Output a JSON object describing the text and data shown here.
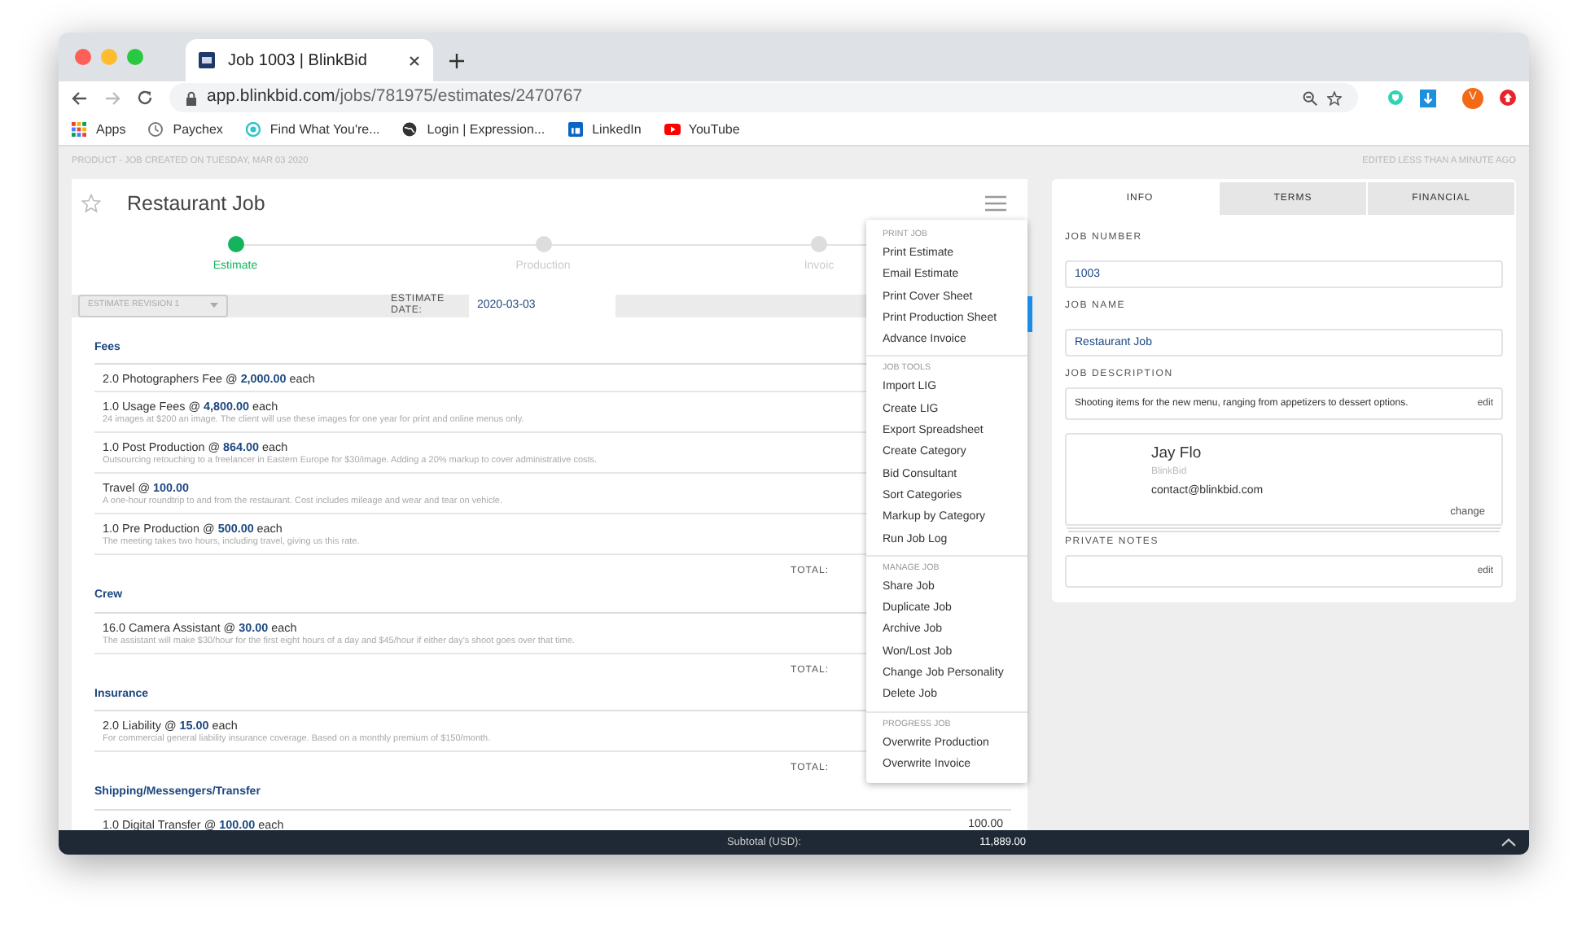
{
  "browser": {
    "tab_title": "Job 1003 | BlinkBid",
    "url_host": "app.blinkbid.com",
    "url_path": "/jobs/781975/estimates/2470767",
    "avatar_letter": "V",
    "bookmarks": [
      {
        "label": "Apps",
        "kind": "apps"
      },
      {
        "label": "Paychex",
        "kind": "clock"
      },
      {
        "label": "Find What You're...",
        "kind": "ring"
      },
      {
        "label": "Login | Expression...",
        "kind": "globe"
      },
      {
        "label": "LinkedIn",
        "kind": "square"
      },
      {
        "label": "YouTube",
        "kind": "play"
      }
    ]
  },
  "meta": {
    "created": "PRODUCT - JOB CREATED ON TUESDAY, MAR 03 2020",
    "edited": "EDITED LESS THAN A MINUTE AGO"
  },
  "job": {
    "title": "Restaurant Job",
    "starred": false,
    "steps": [
      {
        "label": "Estimate",
        "selected": true
      },
      {
        "label": "Production",
        "selected": false
      },
      {
        "label": "Invoic",
        "selected": false
      }
    ],
    "revision": "ESTIMATE REVISION 1",
    "date_label": "ESTIMATE DATE:",
    "date": "2020-03-03"
  },
  "categories": [
    {
      "name": "Fees",
      "total_label": "TOTAL:",
      "items": [
        {
          "line": "2.0 Photographers Fee @ **2,000.00** each"
        },
        {
          "line": "1.0 Usage Fees @ **4,800.00** each",
          "description": "24 images at $200 an image. The client will use these images for one year for print and online menus only."
        },
        {
          "line": "1.0 Post Production @ **864.00** each",
          "description": "Outsourcing retouching to a freelancer in Eastern Europe for $30/image. Adding a 20% markup to cover administrative costs."
        },
        {
          "line": "Travel @ **100.00**",
          "description": "A one-hour roundtrip to and from the restaurant. Cost includes mileage and wear and tear on vehicle."
        },
        {
          "line": "1.0 Pre Production @ **500.00** each",
          "description": "The meeting takes two hours, including travel, giving us this rate."
        }
      ]
    },
    {
      "name": "Crew",
      "total_label": "TOTAL:",
      "items": [
        {
          "line": "16.0 Camera Assistant @ **30.00** each",
          "description": "The assistant will make $30/hour for the first eight hours of a day and $45/hour if either day's shoot goes over that time."
        }
      ]
    },
    {
      "name": "Insurance",
      "total_label": "TOTAL:",
      "items": [
        {
          "line": "2.0 Liability @ **15.00** each",
          "description": "For commercial general liability insurance coverage. Based on a monthly premium of $150/month."
        }
      ]
    },
    {
      "name": "Shipping/Messengers/Transfer",
      "items": [
        {
          "line": "1.0 Digital Transfer @ **100.00** each",
          "amount": "100.00"
        }
      ]
    }
  ],
  "menu": [
    {
      "heading": "PRINT JOB",
      "items": [
        "Print Estimate",
        "Email Estimate",
        "Print Cover Sheet",
        "Print Production Sheet",
        "Advance Invoice"
      ]
    },
    {
      "heading": "JOB TOOLS",
      "items": [
        "Import LIG",
        "Create LIG",
        "Export Spreadsheet",
        "Create Category",
        "Bid Consultant",
        "Sort Categories",
        "Markup by Category",
        "Run Job Log"
      ]
    },
    {
      "heading": "MANAGE JOB",
      "items": [
        "Share Job",
        "Duplicate Job",
        "Archive Job",
        "Won/Lost Job",
        "Change Job Personality",
        "Delete Job"
      ]
    },
    {
      "heading": "PROGRESS JOB",
      "items": [
        "Overwrite Production",
        "Overwrite Invoice"
      ]
    }
  ],
  "info_panel": {
    "tabs": [
      {
        "label": "INFO",
        "selected": true
      },
      {
        "label": "TERMS",
        "selected": false
      },
      {
        "label": "FINANCIAL",
        "selected": false
      }
    ],
    "fields": [
      {
        "kind": "input",
        "label": "JOB NUMBER",
        "value": "1003"
      },
      {
        "kind": "input",
        "label": "JOB NAME",
        "value": "Restaurant Job"
      },
      {
        "kind": "note",
        "label": "JOB DESCRIPTION",
        "value": "Shooting items for the new menu, ranging from appetizers to dessert options.",
        "action": "edit"
      },
      {
        "kind": "contact",
        "name": "Jay Flo",
        "company": "BlinkBid",
        "email": "contact@blinkbid.com",
        "action": "change"
      },
      {
        "kind": "note",
        "label": "PRIVATE NOTES",
        "action": "edit"
      }
    ]
  },
  "footer": {
    "label": "Subtotal (USD):",
    "value": "11,889.00"
  }
}
